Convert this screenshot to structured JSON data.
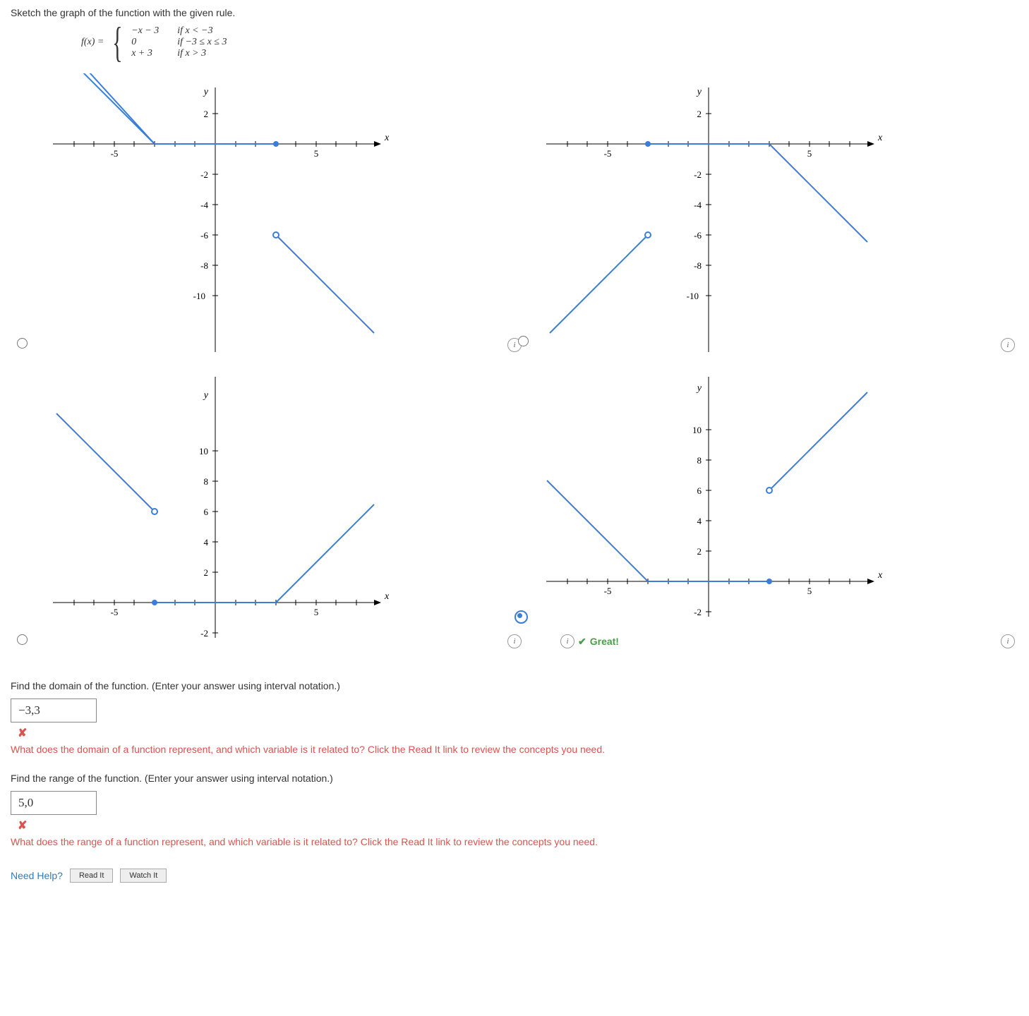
{
  "prompt": "Sketch the graph of the function with the given rule.",
  "function": {
    "lhs": "f(x) = ",
    "pieces": [
      {
        "expr": "−x − 3",
        "cond": "if x < −3"
      },
      {
        "expr": "0",
        "cond": "if −3 ≤ x ≤ 3"
      },
      {
        "expr": "x + 3",
        "cond": "if x > 3"
      }
    ]
  },
  "graphs": {
    "yLabel": "y",
    "xLabel": "x",
    "options": [
      {
        "selected": false
      },
      {
        "selected": false
      },
      {
        "selected": false
      },
      {
        "selected": true
      }
    ],
    "correctFeedback": "Great!"
  },
  "domain": {
    "question": "Find the domain of the function. (Enter your answer using interval notation.)",
    "answer": "−3,3",
    "hint": "What does the domain of a function represent, and which variable is it related to? Click the Read It link to review the concepts you need."
  },
  "range": {
    "question": "Find the range of the function. (Enter your answer using interval notation.)",
    "answer": "5,0",
    "hint": "What does the range of a function represent, and which variable is it related to? Click the Read It link to review the concepts you need."
  },
  "help": {
    "label": "Need Help?",
    "readIt": "Read It",
    "watchIt": "Watch It"
  },
  "chart_data": [
    {
      "type": "line",
      "xlabel": "x",
      "ylabel": "y",
      "xlim": [
        -8,
        8
      ],
      "ylim": [
        -11,
        3
      ],
      "y_ticks": [
        2,
        -2,
        -4,
        -6,
        -8,
        -10
      ],
      "x_ticks": [
        -5,
        5
      ],
      "segments": [
        {
          "from": [
            -8,
            5
          ],
          "to": [
            -3,
            0
          ],
          "endOpen": false
        },
        {
          "from": [
            -3,
            0
          ],
          "to": [
            3,
            0
          ],
          "endOpen": false
        },
        {
          "from": [
            3,
            -6
          ],
          "to": [
            8,
            -11
          ],
          "startOpen": true
        }
      ]
    },
    {
      "type": "line",
      "xlabel": "x",
      "ylabel": "y",
      "xlim": [
        -8,
        8
      ],
      "ylim": [
        -11,
        3
      ],
      "y_ticks": [
        2,
        -2,
        -4,
        -6,
        -8,
        -10
      ],
      "x_ticks": [
        -5,
        5
      ],
      "segments": [
        {
          "from": [
            -8,
            -11
          ],
          "to": [
            -3,
            -6
          ],
          "endOpen": true
        },
        {
          "from": [
            -3,
            0
          ],
          "to": [
            3,
            0
          ],
          "endOpen": false
        },
        {
          "from": [
            3,
            0
          ],
          "to": [
            8,
            -5
          ],
          "startOpen": false
        }
      ]
    },
    {
      "type": "line",
      "xlabel": "x",
      "ylabel": "y",
      "xlim": [
        -8,
        8
      ],
      "ylim": [
        -3,
        11
      ],
      "y_ticks": [
        10,
        8,
        6,
        4,
        2,
        -2
      ],
      "x_ticks": [
        -5,
        5
      ],
      "segments": [
        {
          "from": [
            -8,
            11
          ],
          "to": [
            -3,
            6
          ],
          "endOpen": true
        },
        {
          "from": [
            -3,
            0
          ],
          "to": [
            3,
            0
          ],
          "endOpen": false
        },
        {
          "from": [
            3,
            0
          ],
          "to": [
            8,
            5
          ],
          "startOpen": false
        }
      ]
    },
    {
      "type": "line",
      "xlabel": "x",
      "ylabel": "y",
      "xlim": [
        -8,
        8
      ],
      "ylim": [
        -3,
        11
      ],
      "y_ticks": [
        10,
        8,
        6,
        4,
        2,
        -2
      ],
      "x_ticks": [
        -5,
        5
      ],
      "segments": [
        {
          "from": [
            -8,
            5
          ],
          "to": [
            -3,
            0
          ],
          "endOpen": false
        },
        {
          "from": [
            -3,
            0
          ],
          "to": [
            3,
            0
          ],
          "endOpen": false
        },
        {
          "from": [
            3,
            6
          ],
          "to": [
            8,
            11
          ],
          "startOpen": true
        }
      ]
    }
  ]
}
